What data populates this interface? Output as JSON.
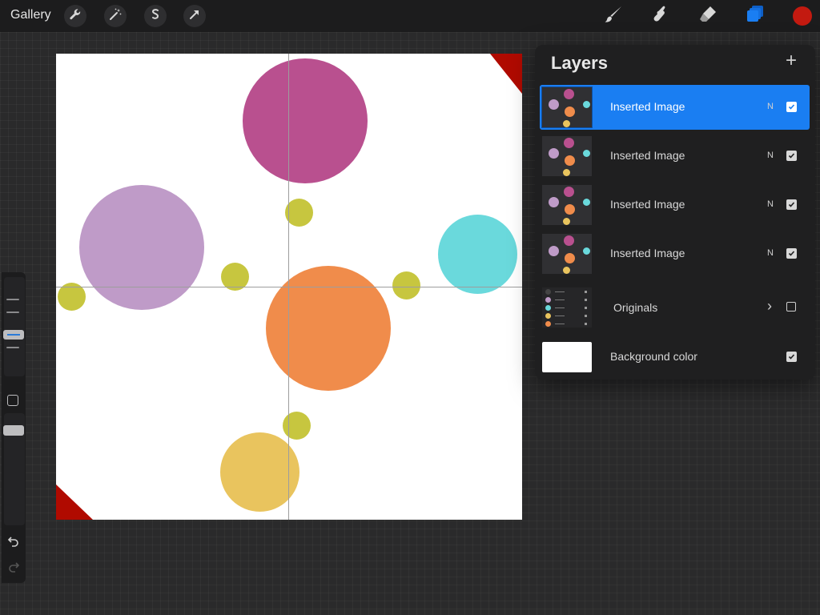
{
  "toolbar": {
    "gallery_label": "Gallery",
    "left_tools": [
      "wrench-icon",
      "magic-wand-icon",
      "selection-icon",
      "transform-arrow-icon"
    ],
    "right_tools": [
      "brush-icon",
      "smudge-icon",
      "eraser-icon",
      "layers-icon"
    ],
    "current_color": "#c31a10",
    "accent_color": "#1a7ef2"
  },
  "canvas": {
    "background": "#ffffff",
    "corner_color": "#b00a00",
    "circle_colors": {
      "magenta": "#b9508f",
      "lavender": "#bf9bc8",
      "cyan": "#6ad9dc",
      "orange": "#f08c4b",
      "yellow": "#e9c45e",
      "olive": "#c7c63f"
    }
  },
  "layers": {
    "title": "Layers",
    "add_label": "+",
    "items": [
      {
        "name": "Inserted Image",
        "blend": "N",
        "visible": true,
        "active": true
      },
      {
        "name": "Inserted Image",
        "blend": "N",
        "visible": true,
        "active": false
      },
      {
        "name": "Inserted Image",
        "blend": "N",
        "visible": true,
        "active": false
      },
      {
        "name": "Inserted Image",
        "blend": "N",
        "visible": true,
        "active": false
      },
      {
        "name": "Originals",
        "blend": "",
        "visible": false,
        "active": false,
        "group": true
      },
      {
        "name": "Background color",
        "blend": "",
        "visible": true,
        "active": false
      }
    ]
  }
}
